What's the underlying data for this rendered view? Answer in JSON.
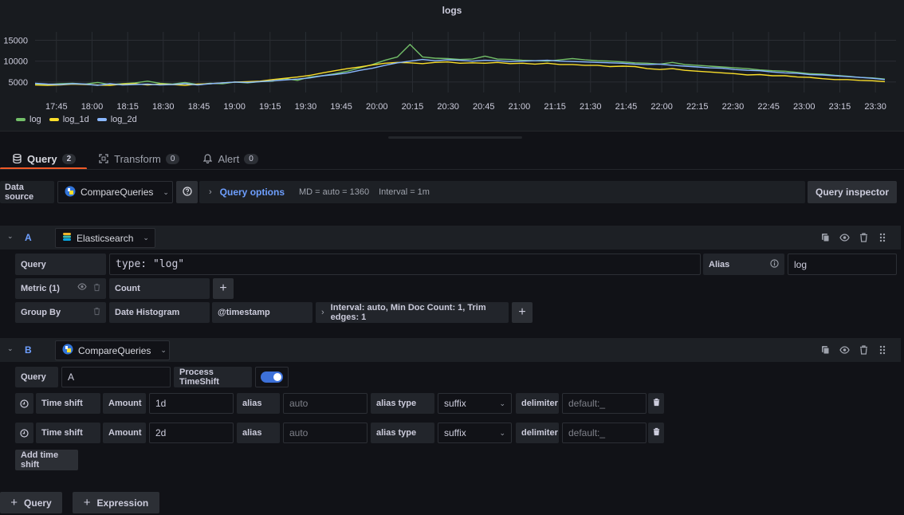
{
  "panel": {
    "title": "logs"
  },
  "chart_data": {
    "type": "line",
    "title": "logs",
    "xlabel": "",
    "ylabel": "",
    "ylim": [
      2500,
      17000
    ],
    "yticks": [
      "5000",
      "10000",
      "15000"
    ],
    "xticks": [
      "17:45",
      "18:00",
      "18:15",
      "18:30",
      "18:45",
      "19:00",
      "19:15",
      "19:30",
      "19:45",
      "20:00",
      "20:15",
      "20:30",
      "20:45",
      "21:00",
      "21:15",
      "21:30",
      "21:45",
      "22:00",
      "22:15",
      "22:30",
      "22:45",
      "23:00",
      "23:15",
      "23:30"
    ],
    "x_start": "17:36",
    "x_end": "23:34",
    "grid": true,
    "legend_position": "bottom-left",
    "series": [
      {
        "name": "log",
        "color": "#73bf69",
        "values": [
          4500,
          4400,
          4600,
          4700,
          4500,
          4900,
          4400,
          4600,
          4800,
          5200,
          4700,
          4500,
          4900,
          4400,
          4700,
          4600,
          5000,
          4800,
          5100,
          5200,
          5800,
          5400,
          6200,
          6500,
          7000,
          7600,
          8400,
          9200,
          10200,
          11000,
          14000,
          11000,
          10700,
          10600,
          10400,
          10500,
          11200,
          10500,
          10400,
          10200,
          10100,
          10000,
          10300,
          10600,
          10300,
          10100,
          10000,
          9800,
          9600,
          9500,
          9300,
          9700,
          9200,
          9000,
          8800,
          8600,
          8400,
          8200,
          7900,
          7700,
          7600,
          7300,
          7000,
          6900,
          6600,
          6400,
          6100,
          6000,
          5700
        ]
      },
      {
        "name": "log_1d",
        "color": "#fade2a",
        "values": [
          4300,
          4200,
          4300,
          4500,
          4400,
          4300,
          4200,
          4500,
          4600,
          4300,
          4500,
          4400,
          4200,
          4500,
          4600,
          4800,
          5000,
          5100,
          5200,
          5600,
          5900,
          6200,
          6600,
          7200,
          7700,
          8200,
          8600,
          9100,
          9500,
          9700,
          9600,
          9400,
          9700,
          9800,
          9500,
          9600,
          9500,
          9700,
          9400,
          9500,
          9300,
          9500,
          9200,
          9200,
          9000,
          9000,
          8700,
          8800,
          8700,
          8200,
          8000,
          8200,
          7800,
          7600,
          7400,
          7200,
          7000,
          6700,
          6800,
          6500,
          6500,
          6200,
          6100,
          5800,
          5600,
          5600,
          5400,
          5300,
          5100
        ]
      },
      {
        "name": "log_2d",
        "color": "#8ab8ff",
        "values": [
          4700,
          4500,
          4400,
          4600,
          4500,
          4200,
          4600,
          4300,
          4400,
          4500,
          4300,
          4400,
          4600,
          4300,
          4600,
          4800,
          5000,
          4900,
          5100,
          5300,
          5500,
          5700,
          6000,
          6500,
          6800,
          7200,
          7800,
          8300,
          9000,
          9600,
          10000,
          10400,
          10100,
          10300,
          10200,
          10000,
          10200,
          10100,
          9900,
          10000,
          10100,
          10200,
          10000,
          9900,
          9800,
          9700,
          9600,
          9500,
          9300,
          9200,
          9300,
          9000,
          8800,
          8600,
          8400,
          8300,
          8000,
          7800,
          7700,
          7400,
          7200,
          7100,
          6800,
          6700,
          6500,
          6300,
          6100,
          5900,
          5600
        ]
      }
    ]
  },
  "tabs": [
    {
      "label": "Query",
      "count": "2",
      "icon": "database-icon"
    },
    {
      "label": "Transform",
      "count": "0",
      "icon": "transform-icon"
    },
    {
      "label": "Alert",
      "count": "0",
      "icon": "bell-icon"
    }
  ],
  "datasource": {
    "label": "Data source",
    "selected": "CompareQueries",
    "help_icon": "question-circle-icon",
    "query_options": {
      "title": "Query options",
      "md": "MD = auto = 1360",
      "interval": "Interval = 1m"
    },
    "inspector_label": "Query inspector"
  },
  "queryA": {
    "letter": "A",
    "datasource": "Elasticsearch",
    "query_label": "Query",
    "query_value": "type: \"log\"",
    "alias_label": "Alias",
    "alias_value": "log",
    "metric_label": "Metric (1)",
    "metric_value": "Count",
    "groupby_label": "Group By",
    "groupby_type": "Date Histogram",
    "groupby_field": "@timestamp",
    "groupby_options": "Interval: auto, Min Doc Count: 1, Trim edges: 1"
  },
  "queryB": {
    "letter": "B",
    "datasource": "CompareQueries",
    "query_label": "Query",
    "query_value": "A",
    "process_label": "Process TimeShift",
    "process_enabled": true,
    "shifts": [
      {
        "label": "Time shift",
        "amount_label": "Amount",
        "amount": "1d",
        "alias_label": "alias",
        "alias_placeholder": "auto",
        "alias_type_label": "alias type",
        "alias_type": "suffix",
        "delimiter_label": "delimiter",
        "delimiter_placeholder": "default:_"
      },
      {
        "label": "Time shift",
        "amount_label": "Amount",
        "amount": "2d",
        "alias_label": "alias",
        "alias_placeholder": "auto",
        "alias_type_label": "alias type",
        "alias_type": "suffix",
        "delimiter_label": "delimiter",
        "delimiter_placeholder": "default:_"
      }
    ],
    "add_shift_label": "Add time shift"
  },
  "footer": {
    "add_query_label": "Query",
    "add_expression_label": "Expression"
  }
}
